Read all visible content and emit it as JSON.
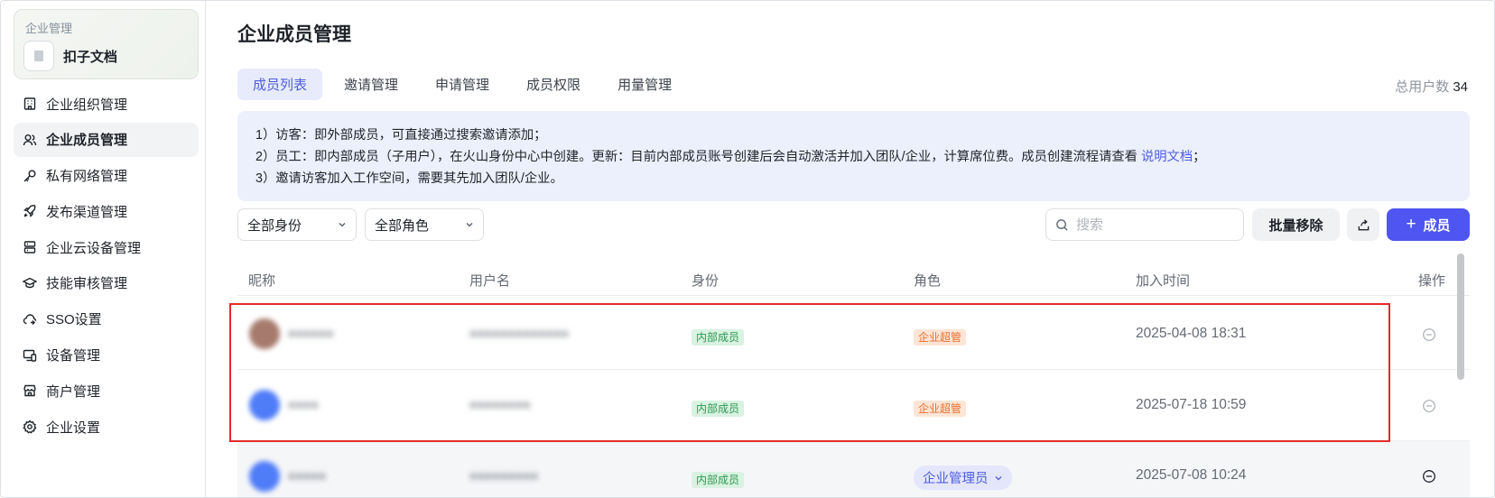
{
  "sidebar": {
    "enterprise_label": "企业管理",
    "enterprise_name": "扣子文档",
    "items": [
      {
        "label": "企业组织管理",
        "icon": "building-icon"
      },
      {
        "label": "企业成员管理",
        "icon": "users-icon",
        "active": true
      },
      {
        "label": "私有网络管理",
        "icon": "key-icon"
      },
      {
        "label": "发布渠道管理",
        "icon": "rocket-icon"
      },
      {
        "label": "企业云设备管理",
        "icon": "server-icon"
      },
      {
        "label": "技能审核管理",
        "icon": "graduation-cap-icon"
      },
      {
        "label": "SSO设置",
        "icon": "cloud-link-icon"
      },
      {
        "label": "设备管理",
        "icon": "devices-icon"
      },
      {
        "label": "商户管理",
        "icon": "store-icon"
      },
      {
        "label": "企业设置",
        "icon": "gear-icon"
      }
    ]
  },
  "main": {
    "title": "企业成员管理",
    "tabs": [
      {
        "label": "成员列表",
        "active": true
      },
      {
        "label": "邀请管理"
      },
      {
        "label": "申请管理"
      },
      {
        "label": "成员权限"
      },
      {
        "label": "用量管理"
      }
    ],
    "total_label": "总用户数",
    "total_count": "34",
    "notice": {
      "line1": "1）访客：即外部成员，可直接通过搜索邀请添加；",
      "line2_prefix": "2）员工：即内部成员（子用户），在火山身份中心中创建。更新：目前内部成员账号创建后会自动激活并加入团队/企业，计算席位费。成员创建流程请查看 ",
      "line2_link": "说明文档",
      "line2_suffix": "；",
      "line3": "3）邀请访客加入工作空间，需要其先加入团队/企业。"
    },
    "filters": {
      "identity": "全部身份",
      "role": "全部角色"
    },
    "search_placeholder": "搜索",
    "batch_remove_label": "批量移除",
    "add_member_label": "成员",
    "table": {
      "headers": {
        "nickname": "昵称",
        "username": "用户名",
        "identity": "身份",
        "role": "角色",
        "joined": "加入时间",
        "action": "操作"
      },
      "rows": [
        {
          "nickname": "●●●●●●",
          "username": "●●●●●●●●●●●●●",
          "identity": "内部成员",
          "role": "企业超管",
          "role_type": "tag",
          "joined": "2025-04-08 18:31",
          "avatar_color": "#a67a6c"
        },
        {
          "nickname": "●●●●",
          "username": "●●●●●●●●",
          "identity": "内部成员",
          "role": "企业超管",
          "role_type": "tag",
          "joined": "2025-07-18 10:59",
          "avatar_color": "#4f7cf7"
        },
        {
          "nickname": "●●●●●",
          "username": "●●●●●●●●●",
          "identity": "内部成员",
          "role": "企业管理员",
          "role_type": "select",
          "joined": "2025-07-08 10:24",
          "avatar_color": "#4f7cf7"
        }
      ]
    }
  }
}
